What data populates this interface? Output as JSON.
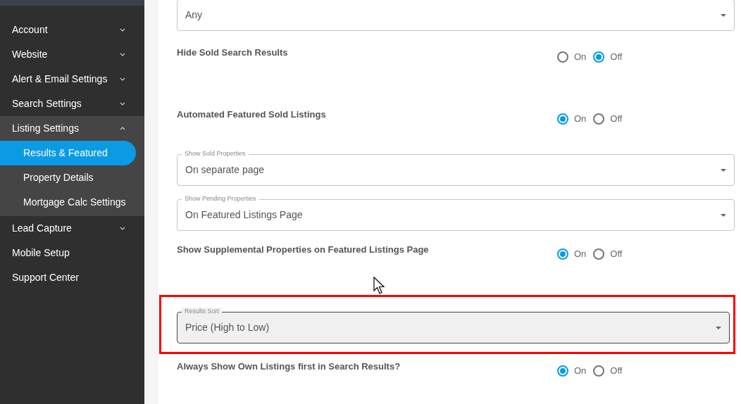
{
  "sidebar": {
    "items": [
      {
        "label": "Account",
        "expandable": true,
        "expanded": false
      },
      {
        "label": "Website",
        "expandable": true,
        "expanded": false
      },
      {
        "label": "Alert & Email Settings",
        "expandable": true,
        "expanded": false
      },
      {
        "label": "Search Settings",
        "expandable": true,
        "expanded": false
      },
      {
        "label": "Listing Settings",
        "expandable": true,
        "expanded": true,
        "children": [
          {
            "label": "Results & Featured",
            "selected": true
          },
          {
            "label": "Property Details",
            "selected": false
          },
          {
            "label": "Mortgage Calc Settings",
            "selected": false
          }
        ]
      },
      {
        "label": "Lead Capture",
        "expandable": true,
        "expanded": false
      },
      {
        "label": "Mobile Setup",
        "expandable": false,
        "expanded": false
      },
      {
        "label": "Support Center",
        "expandable": false,
        "expanded": false
      }
    ]
  },
  "settings": [
    {
      "kind": "select",
      "value": "Any",
      "highlighted": false
    },
    {
      "kind": "radio",
      "label": "Hide Sold Search Results",
      "options": [
        {
          "label": "On",
          "selected": false
        },
        {
          "label": "Off",
          "selected": true
        }
      ]
    },
    {
      "kind": "radio",
      "label": "Automated Featured Sold Listings",
      "options": [
        {
          "label": "On",
          "selected": true
        },
        {
          "label": "Off",
          "selected": false
        }
      ]
    },
    {
      "kind": "select",
      "legend": "Show Sold Properties",
      "value": "On separate page",
      "highlighted": false
    },
    {
      "kind": "select",
      "legend": "Show Pending Properties",
      "value": "On Featured Listings Page",
      "highlighted": false
    },
    {
      "kind": "radio",
      "label": "Show Supplemental Properties on Featured Listings Page",
      "options": [
        {
          "label": "On",
          "selected": true
        },
        {
          "label": "Off",
          "selected": false
        }
      ]
    },
    {
      "kind": "select",
      "legend": "Results Sort",
      "value": "Price (High to Low)",
      "highlighted": true
    },
    {
      "kind": "radio",
      "label": "Always Show Own Listings first in Search Results?",
      "options": [
        {
          "label": "On",
          "selected": true
        },
        {
          "label": "Off",
          "selected": false
        }
      ]
    }
  ]
}
